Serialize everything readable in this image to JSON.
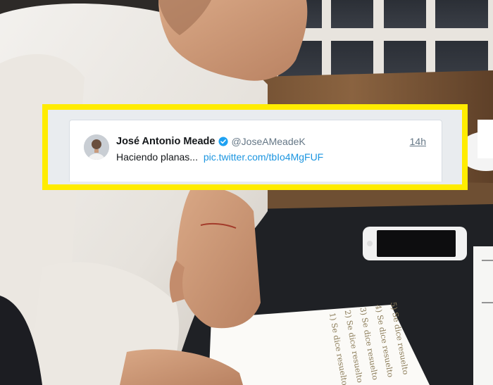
{
  "tweet": {
    "display_name": "José Antonio Meade",
    "handle": "@JoseAMeadeK",
    "timestamp": "14h",
    "text": "Haciendo planas...",
    "link": "pic.twitter.com/tbIo4MgFUF",
    "verified": true,
    "avatar_icon": "user-avatar",
    "verified_icon": "verified-badge-icon"
  },
  "photo": {
    "paper_lines": [
      "1) Se dice resuelto",
      "2) Se dice resuelto",
      "3) Se dice resuelto",
      "4) Se dice resuelto",
      "5) Se dice resuelto"
    ]
  },
  "colors": {
    "highlight_frame": "#ffec00",
    "link": "#1b95e0",
    "verified": "#1da1f2"
  }
}
